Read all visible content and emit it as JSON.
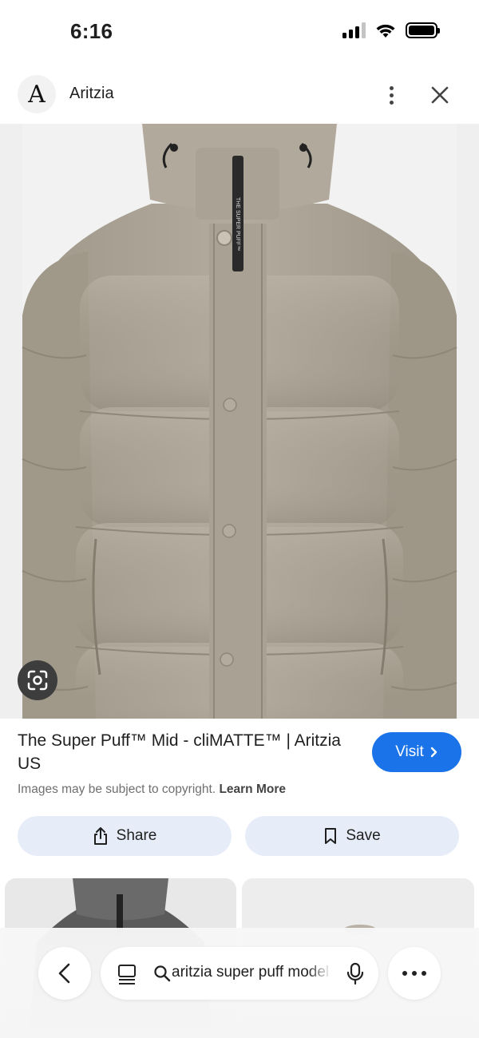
{
  "status_bar": {
    "time": "6:16",
    "battery_level": 1.0
  },
  "site": {
    "logo_letter": "A",
    "name": "Aritzia"
  },
  "result": {
    "title": "The Super Puff™ Mid - cliMATTE™ | Aritzia US",
    "visit_label": "Visit",
    "copyright_text": "Images may be subject to copyright.",
    "learn_more": "Learn More"
  },
  "actions": {
    "share_label": "Share",
    "save_label": "Save"
  },
  "jacket_label": "THE SUPER PUFF™",
  "search": {
    "query": "aritzia super puff model"
  },
  "icons": {
    "more": "more-vertical-icon",
    "close": "close-icon",
    "lens": "google-lens-icon",
    "chevron": "chevron-right-icon",
    "share": "share-icon",
    "save": "bookmark-icon",
    "back": "chevron-left-icon",
    "tabs": "tabs-icon",
    "search": "search-icon",
    "mic": "mic-icon",
    "menu": "more-horizontal-icon"
  },
  "colors": {
    "accent": "#1a73e8",
    "action_bg": "#e6edf9",
    "jacket": "#aea699"
  }
}
